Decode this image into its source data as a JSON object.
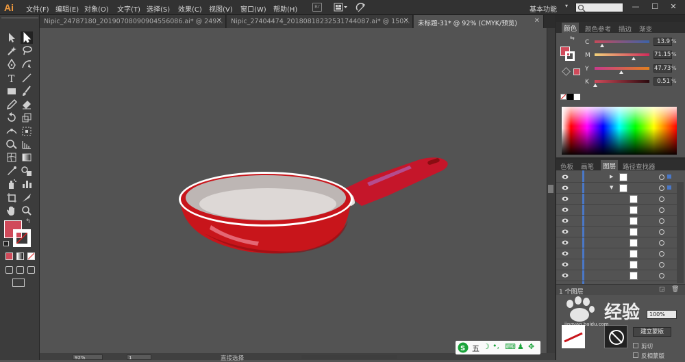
{
  "app": {
    "logo": "Ai",
    "workspace_label": "基本功能",
    "bridge_label": "Br"
  },
  "menu": [
    {
      "id": "file",
      "label": "文件(F)"
    },
    {
      "id": "edit",
      "label": "编辑(E)"
    },
    {
      "id": "object",
      "label": "对象(O)"
    },
    {
      "id": "text",
      "label": "文字(T)"
    },
    {
      "id": "select",
      "label": "选择(S)"
    },
    {
      "id": "effect",
      "label": "效果(C)"
    },
    {
      "id": "view",
      "label": "视图(V)"
    },
    {
      "id": "window",
      "label": "窗口(W)"
    },
    {
      "id": "help",
      "label": "帮助(H)"
    }
  ],
  "window_controls": {
    "minimize": "—",
    "maximize": "☐",
    "close": "✕"
  },
  "tabs": [
    {
      "label": "Nipic_24787180_20190708090904556086.ai* @ 249...",
      "active": false
    },
    {
      "label": "Nipic_27404474_20180818232531744087.ai* @ 150...",
      "active": false
    },
    {
      "label": "未标题-31* @ 92% (CMYK/预览)",
      "active": true
    }
  ],
  "color_panel": {
    "tabs": [
      "颜色",
      "颜色参考",
      "描边",
      "渐变"
    ],
    "active_tab": "颜色",
    "sliders": [
      {
        "label": "C",
        "value": "13.9",
        "unit": "%",
        "fraction": 0.139
      },
      {
        "label": "M",
        "value": "71.15",
        "unit": "%",
        "fraction": 0.7115
      },
      {
        "label": "Y",
        "value": "47.73",
        "unit": "%",
        "fraction": 0.4773
      },
      {
        "label": "K",
        "value": "0.51",
        "unit": "%",
        "fraction": 0.0051
      }
    ],
    "fill_color": "#d04a5a",
    "stroke_color": "#ffffff"
  },
  "layers_panel": {
    "tabs": [
      "色板",
      "画笔",
      "图层",
      "路径查找器"
    ],
    "active_tab": "图层",
    "rows": 10,
    "footer_label": "1 个图层"
  },
  "bottom_panel": {
    "opacity_value": "100%",
    "make_mask_label": "建立蒙版",
    "clip_label": "剪切",
    "invert_mask_label": "反相蒙版"
  },
  "watermark": {
    "text": "经验",
    "sub": "jingyan.baidu.com"
  },
  "status": {
    "zoom": "92%",
    "artboard": "1",
    "tool_label": "直接选择"
  },
  "ime": {
    "label": "五"
  },
  "colors": {
    "pan_red": "#c8151b",
    "pan_red_dark": "#8a0d12",
    "pan_inner": "#bdb6b4",
    "pan_rim": "#ffffff",
    "handle_red": "#c5162a",
    "handle_highlight": "#b05aa8",
    "canvas_bg": "#535353",
    "brand_orange": "#f09a3e"
  }
}
